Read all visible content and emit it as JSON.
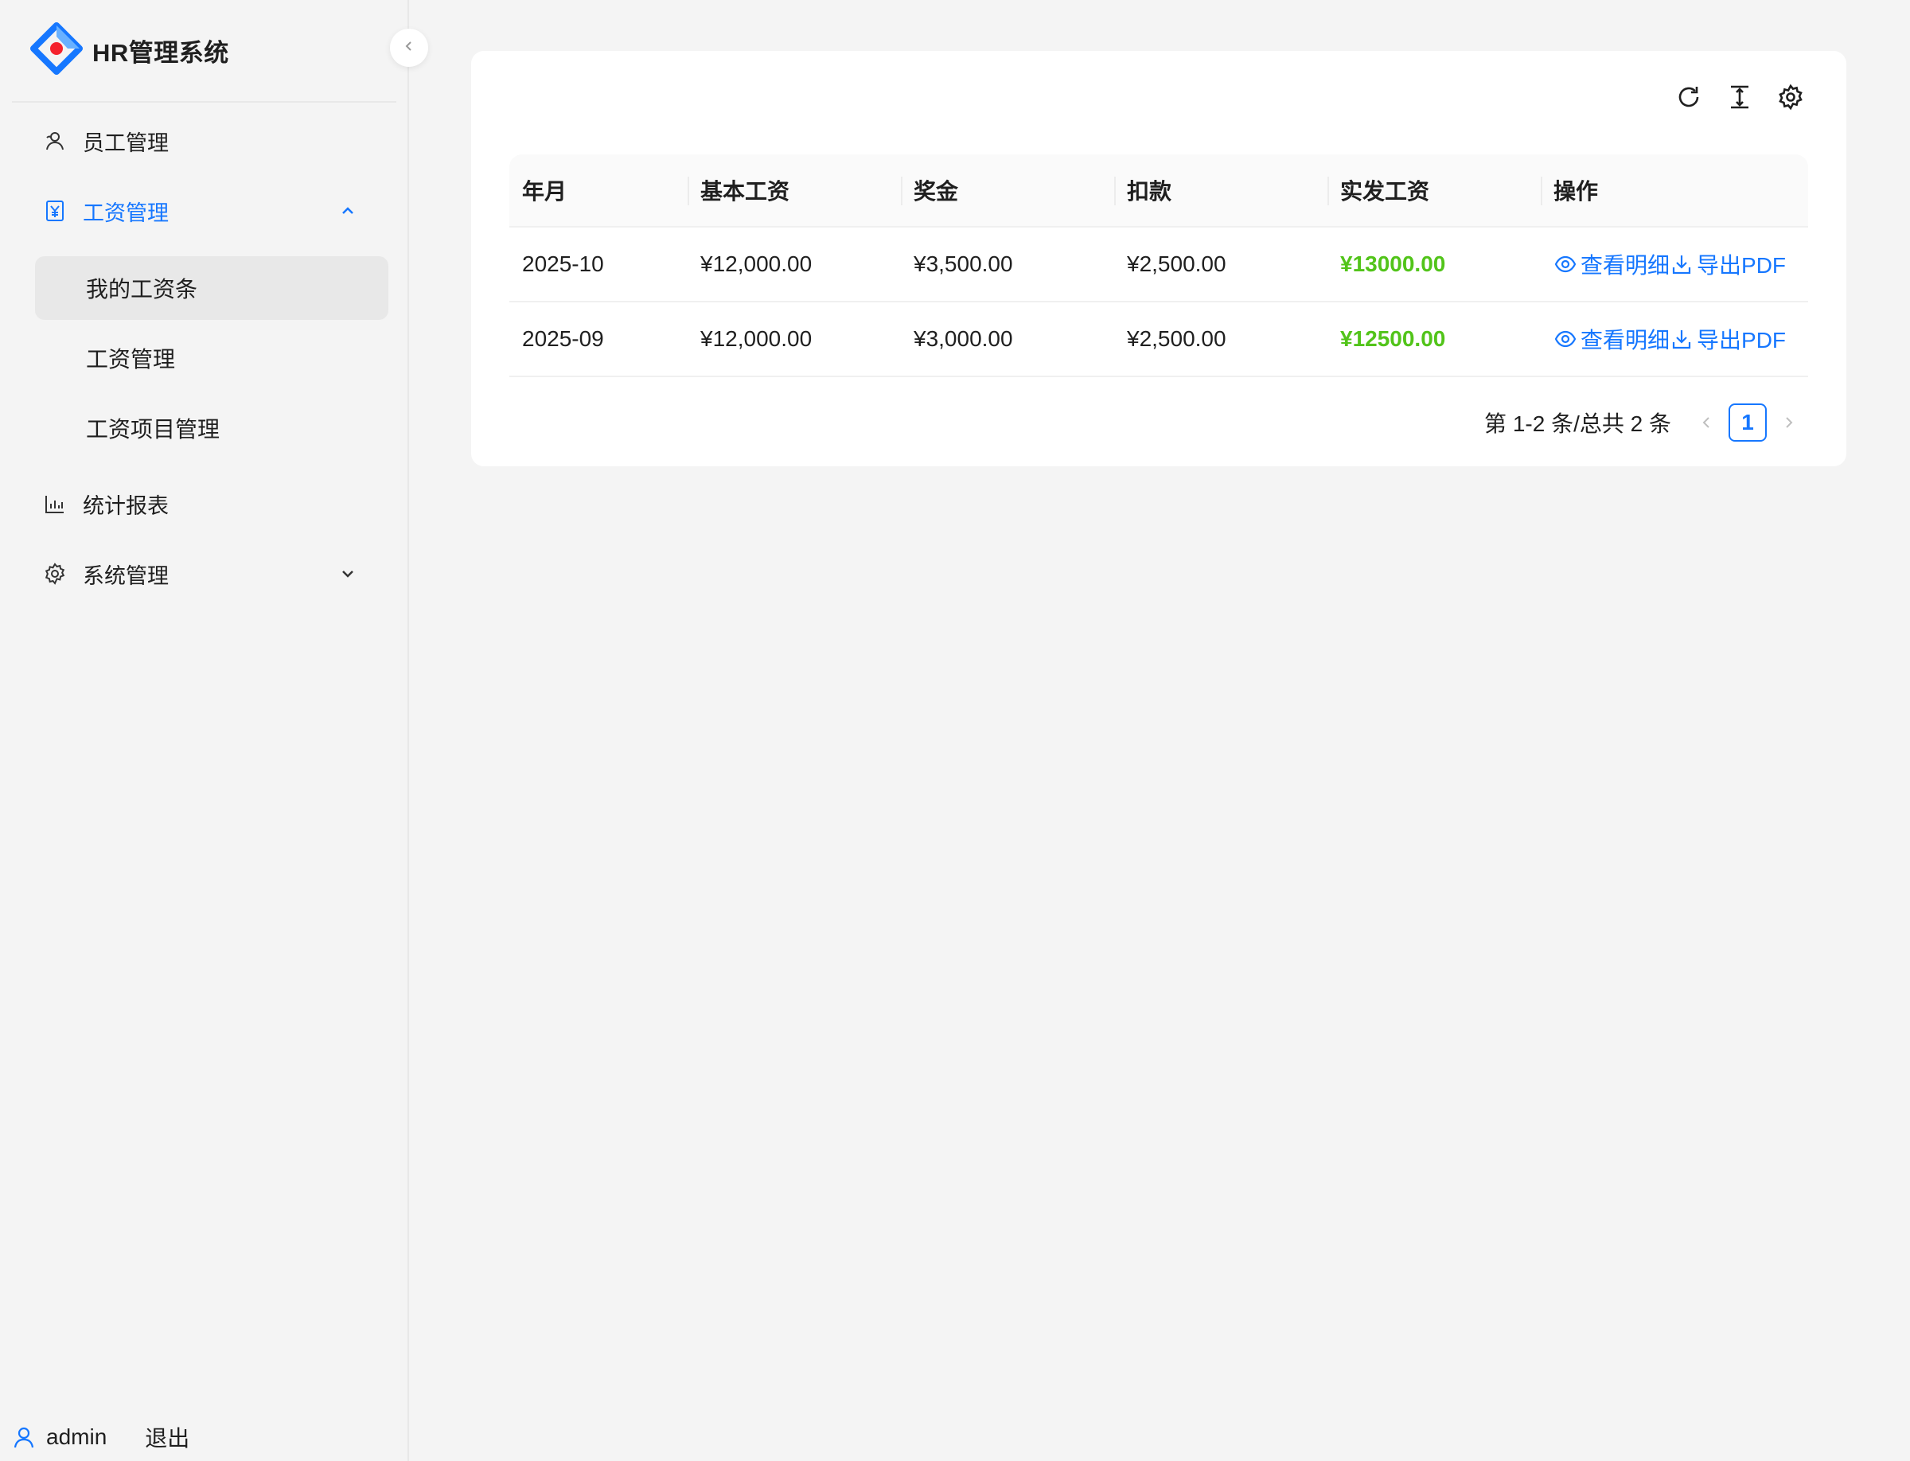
{
  "app": {
    "title": "HR管理系统"
  },
  "sidebar": {
    "items": [
      {
        "label": "员工管理",
        "icon": "users-icon"
      },
      {
        "label": "工资管理",
        "icon": "yen-icon",
        "expanded": true,
        "active": true,
        "children": [
          {
            "label": "我的工资条",
            "selected": true
          },
          {
            "label": "工资管理"
          },
          {
            "label": "工资项目管理"
          }
        ]
      },
      {
        "label": "统计报表",
        "icon": "bar-chart-icon"
      },
      {
        "label": "系统管理",
        "icon": "settings-icon",
        "expanded": false
      }
    ]
  },
  "user": {
    "name": "admin",
    "logout_label": "退出"
  },
  "table": {
    "columns": [
      "年月",
      "基本工资",
      "奖金",
      "扣款",
      "实发工资",
      "操作"
    ],
    "rows": [
      {
        "month": "2025-10",
        "base": "¥12,000.00",
        "bonus": "¥3,500.00",
        "deduction": "¥2,500.00",
        "net": "¥13000.00"
      },
      {
        "month": "2025-09",
        "base": "¥12,000.00",
        "bonus": "¥3,000.00",
        "deduction": "¥2,500.00",
        "net": "¥12500.00"
      }
    ],
    "actions": {
      "view": "查看明细",
      "export": "导出PDF"
    }
  },
  "pagination": {
    "total_text": "第 1-2 条/总共 2 条",
    "current_page": "1"
  },
  "colors": {
    "accent": "#1677ff",
    "net_pay": "#52c41a",
    "background": "#f4f4f4"
  }
}
